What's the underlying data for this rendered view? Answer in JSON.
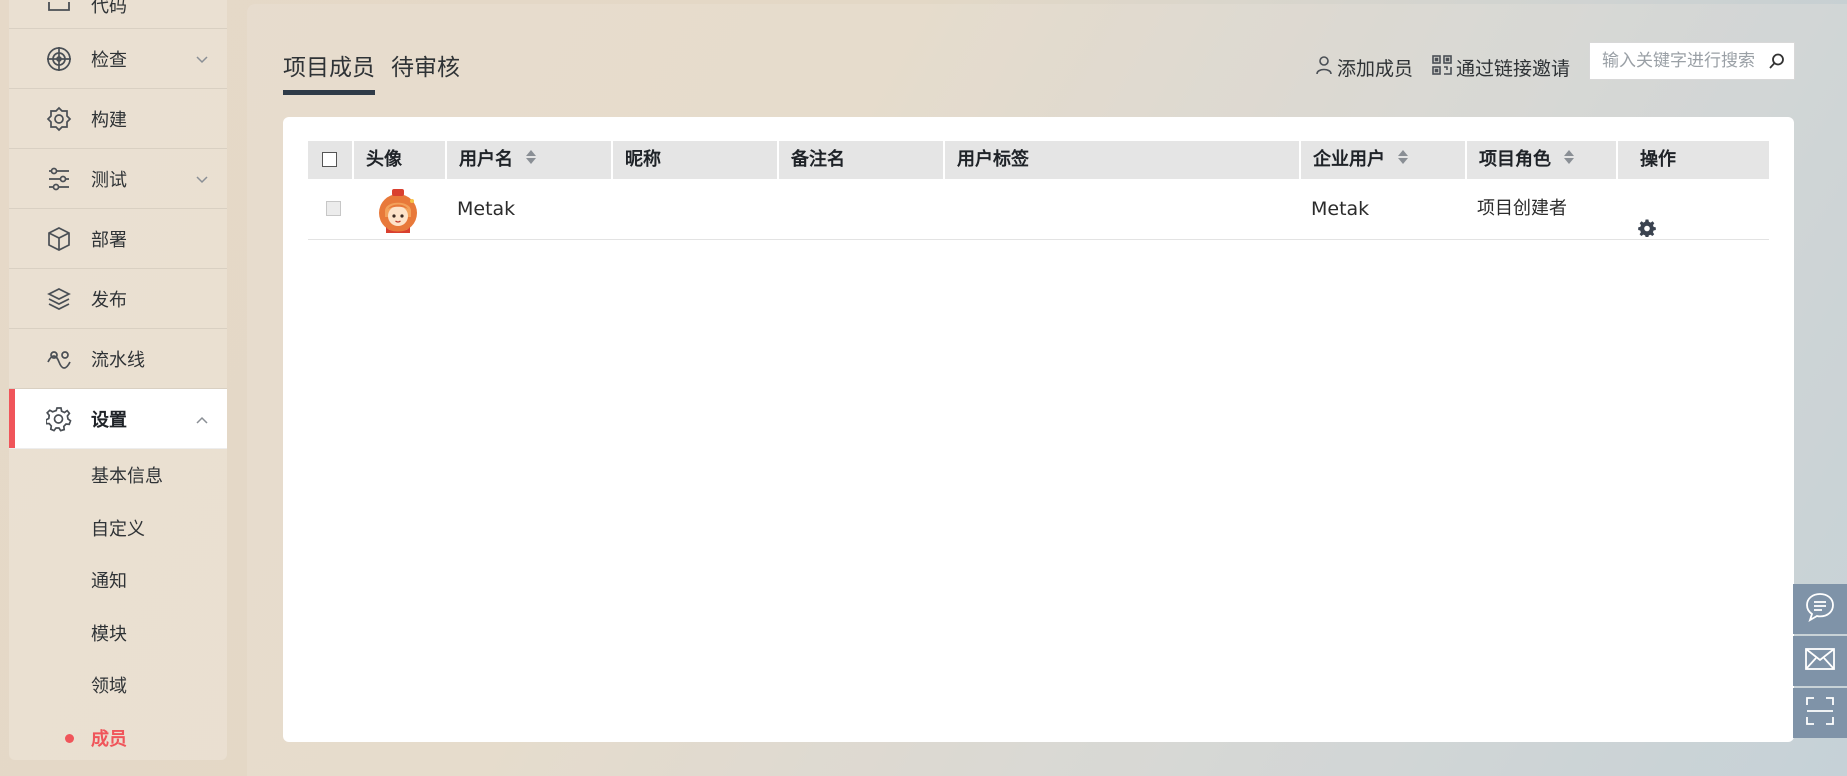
{
  "sidebar": {
    "items": [
      {
        "label": "代码",
        "icon": "code-icon"
      },
      {
        "label": "检查",
        "icon": "radar-icon",
        "chevron": "down"
      },
      {
        "label": "构建",
        "icon": "build-gear-icon"
      },
      {
        "label": "测试",
        "icon": "test-icon",
        "chevron": "down"
      },
      {
        "label": "部署",
        "icon": "cube-icon"
      },
      {
        "label": "发布",
        "icon": "release-icon"
      },
      {
        "label": "流水线",
        "icon": "pipeline-icon"
      },
      {
        "label": "设置",
        "icon": "settings-icon",
        "chevron": "up"
      }
    ],
    "sub_items": [
      {
        "label": "基本信息"
      },
      {
        "label": "自定义"
      },
      {
        "label": "通知"
      },
      {
        "label": "模块"
      },
      {
        "label": "领域"
      },
      {
        "label": "成员"
      }
    ],
    "accent_color": "#f0555a"
  },
  "tabs": [
    {
      "label": "项目成员",
      "active": true
    },
    {
      "label": "待审核",
      "active": false
    }
  ],
  "toolbar": {
    "add_member": "添加成员",
    "invite_link": "通过链接邀请",
    "search_placeholder": "输入关键字进行搜索"
  },
  "table": {
    "columns": [
      "头像",
      "用户名",
      "昵称",
      "备注名",
      "用户标签",
      "企业用户",
      "项目角色",
      "操作"
    ],
    "rows": [
      {
        "username": "Metak",
        "nickname": "",
        "remark": "",
        "tags": "",
        "enterprise_user": "Metak",
        "role": "项目创建者"
      }
    ]
  },
  "float_buttons": [
    "chat-icon",
    "mail-icon",
    "scan-icon"
  ]
}
